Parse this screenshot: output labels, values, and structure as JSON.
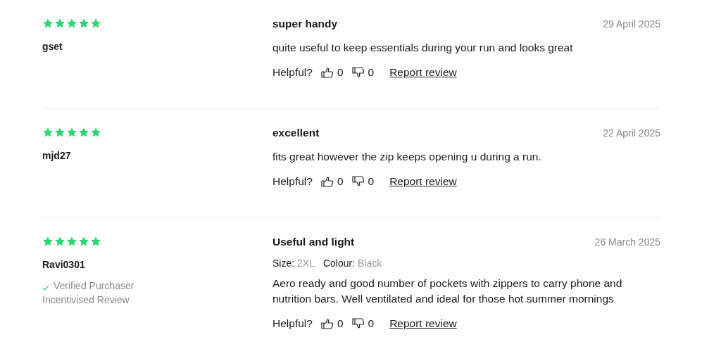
{
  "reviews": [
    {
      "stars": 5,
      "author": "gset",
      "title": "super handy",
      "date": "29 April 2025",
      "body": "quite useful to keep essentials during your run and looks great",
      "helpful_label": "Helpful?",
      "up_count": "0",
      "down_count": "0",
      "report": "Report review"
    },
    {
      "stars": 5,
      "author": "mjd27",
      "title": "excellent",
      "date": "22 April 2025",
      "body": "fits great however the zip keeps opening u during a run.",
      "helpful_label": "Helpful?",
      "up_count": "0",
      "down_count": "0",
      "report": "Report review"
    },
    {
      "stars": 5,
      "author": "Ravi0301",
      "verified": true,
      "verified_label": "Verified Purchaser",
      "incentivised": "Incentivised Review",
      "title": "Useful and light",
      "date": "26 March 2025",
      "attributes": [
        {
          "label": "Size:",
          "value": "2XL"
        },
        {
          "label": "Colour:",
          "value": "Black"
        }
      ],
      "body": "Aero ready and good number of pockets with zippers to carry phone and nutrition bars. Well ventilated and ideal for those hot summer mornings",
      "helpful_label": "Helpful?",
      "up_count": "0",
      "down_count": "0",
      "report": "Report review"
    }
  ]
}
